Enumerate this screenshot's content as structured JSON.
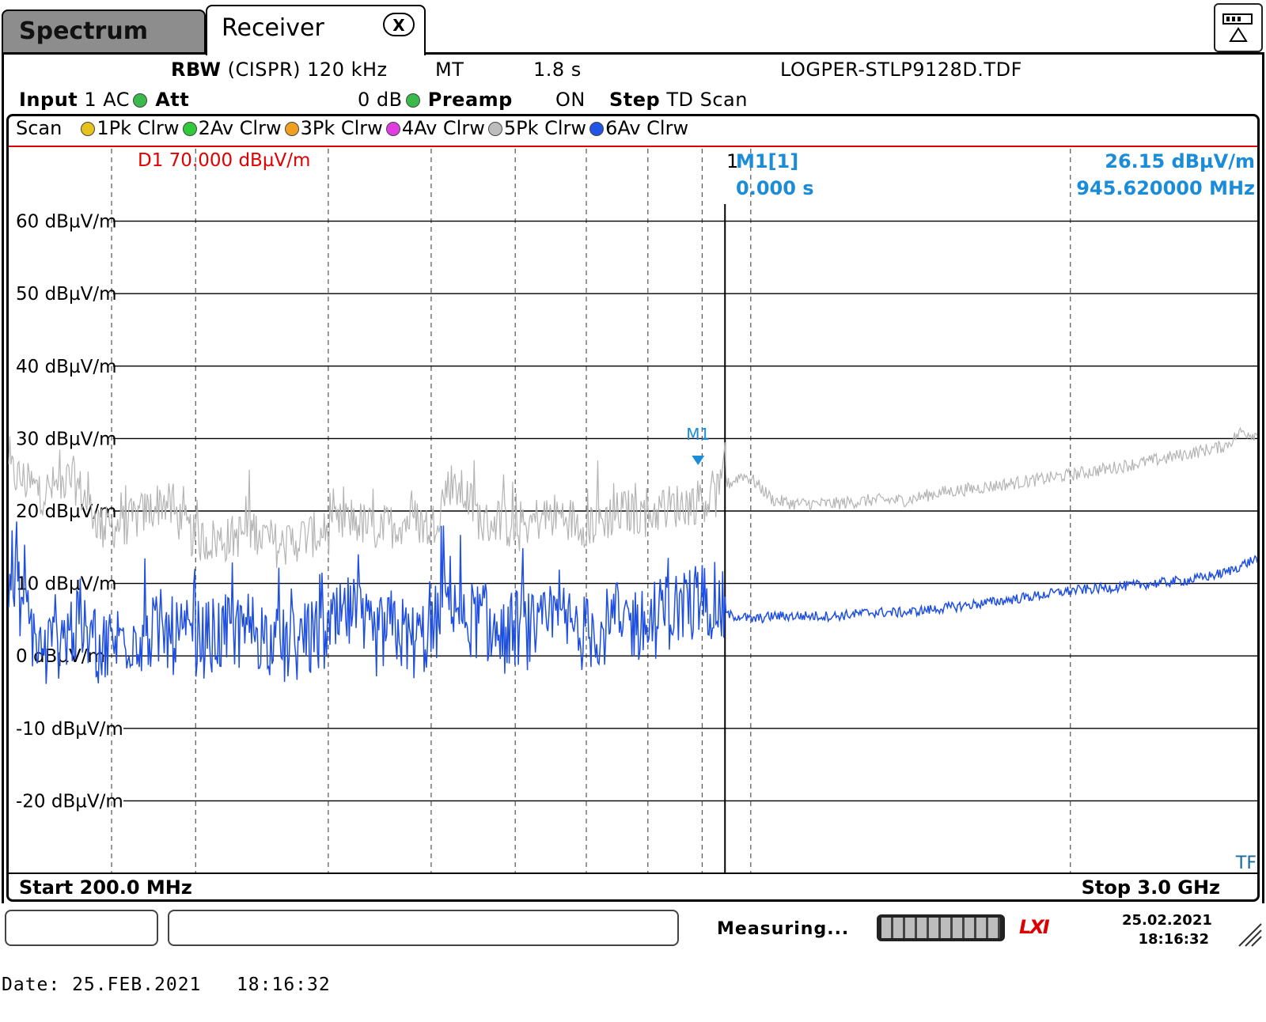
{
  "tabs": [
    {
      "label": "Spectrum",
      "active": false
    },
    {
      "label": "Receiver",
      "active": true,
      "close_label": "X"
    }
  ],
  "settings": {
    "rbw_label": "RBW",
    "rbw_value": "(CISPR) 120 kHz",
    "mt_label": "MT",
    "mt_value": "1.8 s",
    "transducer_file": "LOGPER-STLP9128D.TDF",
    "input_label": "Input",
    "input_value": "1 AC",
    "att_label": "Att",
    "att_value": "0 dB",
    "preamp_label": "Preamp",
    "preamp_value": "ON",
    "step_label": "Step",
    "step_value": "TD Scan"
  },
  "trace_legend": {
    "label": "Scan",
    "traces": [
      {
        "name": "1Pk Clrw",
        "color": "#e6c31c"
      },
      {
        "name": "2Av Clrw",
        "color": "#2fc93a"
      },
      {
        "name": "3Pk Clrw",
        "color": "#f0a020"
      },
      {
        "name": "4Av Clrw",
        "color": "#e03ce0"
      },
      {
        "name": "5Pk Clrw",
        "color": "#bdbdbd"
      },
      {
        "name": "6Av Clrw",
        "color": "#2255e6"
      }
    ]
  },
  "display_line": {
    "label": "D1 70.000 dBµV/m",
    "color": "#e00000"
  },
  "marker": {
    "index_label": "1",
    "name_label": "M1[1]",
    "time_label": "0.000 s",
    "level_label": "26.15 dBµV/m",
    "freq_label": "945.620000 MHz",
    "tag_label": "M1",
    "color": "#1a8cd8"
  },
  "tf_label": "TF",
  "footer": {
    "start": "Start 200.0 MHz",
    "stop": "Stop 3.0 GHz"
  },
  "status": {
    "text": "Measuring...",
    "date": "25.02.2021",
    "time": "18:16:32",
    "logo": "LXI"
  },
  "print_date": "Date: 25.FEB.2021   18:16:32",
  "chart_data": {
    "type": "line",
    "xlabel": "",
    "ylabel": "",
    "x_unit": "MHz",
    "xlim": [
      200,
      3000
    ],
    "ylim": [
      -30,
      70
    ],
    "y_ticks": [
      {
        "value": 60,
        "label": "60 dBµV/m"
      },
      {
        "value": 50,
        "label": "50 dBµV/m"
      },
      {
        "value": 40,
        "label": "40 dBµV/m"
      },
      {
        "value": 30,
        "label": "30 dBµV/m"
      },
      {
        "value": 20,
        "label": "20 dBµV/m"
      },
      {
        "value": 10,
        "label": "10 dBµV/m"
      },
      {
        "value": 0,
        "label": "0 dBµV/m"
      },
      {
        "value": -10,
        "label": "-10 dBµV/m"
      },
      {
        "value": -20,
        "label": "-20 dBµV/m"
      }
    ],
    "vertical_grid_mhz": [
      250,
      300,
      400,
      500,
      600,
      700,
      800,
      900,
      1000,
      2000
    ],
    "marker_line_mhz": 945.62,
    "series": [
      {
        "name": "5Pk Clrw",
        "color": "#b4b4b4",
        "x": [
          200,
          215,
          230,
          245,
          260,
          280,
          300,
          320,
          340,
          360,
          380,
          400,
          420,
          440,
          460,
          480,
          500,
          520,
          540,
          560,
          580,
          600,
          630,
          660,
          700,
          730,
          760,
          800,
          830,
          870,
          900,
          925,
          945,
          960,
          980,
          1000,
          1050,
          1100,
          1150,
          1200,
          1300,
          1400,
          1500,
          1600,
          1700,
          1800,
          1900,
          2000,
          2200,
          2400,
          2600,
          2800,
          2900,
          3000
        ],
        "y": [
          25.5,
          22.5,
          24.5,
          17.5,
          18.5,
          21.5,
          16.0,
          16.0,
          17.5,
          15.0,
          16.5,
          17.0,
          19.0,
          17.5,
          18.0,
          19.0,
          17.5,
          24.0,
          22.0,
          18.0,
          19.0,
          17.0,
          19.0,
          19.5,
          18.0,
          19.0,
          20.0,
          19.5,
          20.5,
          21.0,
          21.5,
          22.0,
          23.5,
          24.0,
          25.0,
          24.5,
          21.5,
          21.0,
          21.0,
          21.0,
          21.5,
          21.5,
          22.5,
          23.0,
          23.5,
          24.0,
          24.5,
          25.0,
          26.0,
          27.0,
          28.0,
          29.0,
          31.0,
          30.5
        ]
      },
      {
        "name": "6Av Clrw",
        "color": "#1f4fe0",
        "x": [
          200,
          215,
          230,
          245,
          260,
          280,
          300,
          320,
          340,
          360,
          380,
          400,
          420,
          440,
          460,
          480,
          500,
          520,
          540,
          560,
          580,
          600,
          630,
          660,
          700,
          730,
          760,
          800,
          830,
          870,
          900,
          925,
          945,
          960,
          980,
          1000,
          1050,
          1100,
          1150,
          1200,
          1300,
          1400,
          1500,
          1600,
          1700,
          1800,
          1900,
          2000,
          2200,
          2400,
          2600,
          2800,
          2900,
          3000
        ],
        "y": [
          12.0,
          0.0,
          4.0,
          1.0,
          3.0,
          3.0,
          2.0,
          3.0,
          4.0,
          1.0,
          2.0,
          3.0,
          6.0,
          2.0,
          4.0,
          2.0,
          3.0,
          9.0,
          5.0,
          5.0,
          2.0,
          4.0,
          3.0,
          5.0,
          3.0,
          4.0,
          5.0,
          4.0,
          6.0,
          7.0,
          8.0,
          7.5,
          6.0,
          5.5,
          5.5,
          5.0,
          5.5,
          5.5,
          5.5,
          5.5,
          6.0,
          6.0,
          6.5,
          7.0,
          7.5,
          8.0,
          8.5,
          9.0,
          9.5,
          10.0,
          10.5,
          11.5,
          12.5,
          13.5
        ]
      }
    ]
  }
}
